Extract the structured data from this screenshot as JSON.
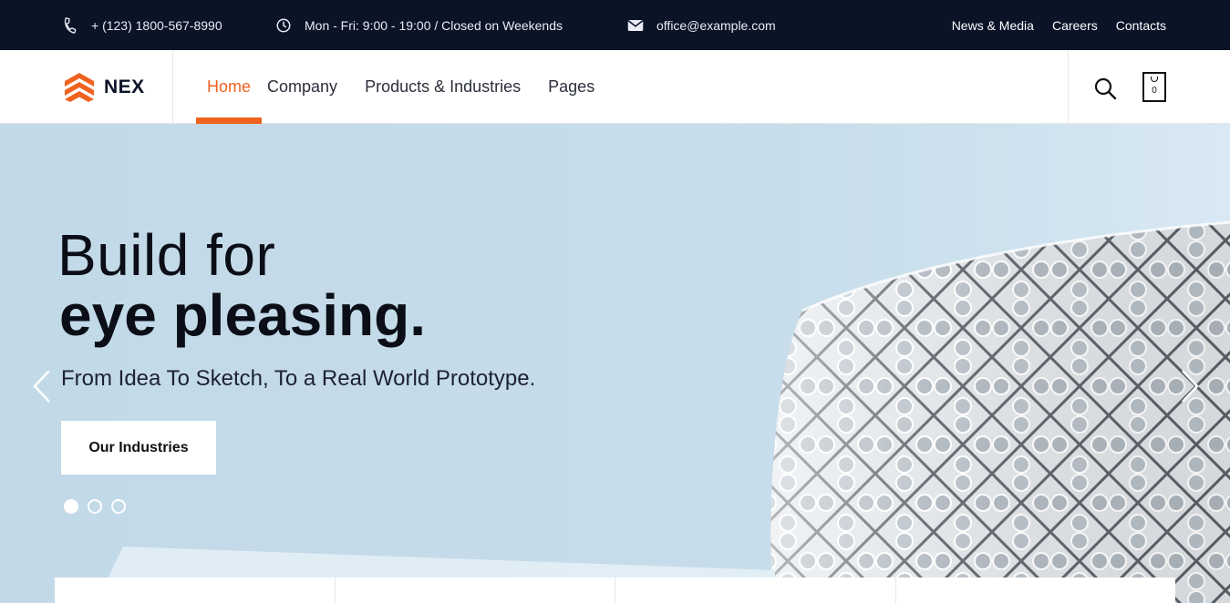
{
  "topbar": {
    "phone": "+ (123) 1800-567-8990",
    "hours": "Mon - Fri: 9:00 - 19:00 / Closed on Weekends",
    "email": "office@example.com",
    "links": [
      "News & Media",
      "Careers",
      "Contacts"
    ],
    "icons": [
      "phone-icon",
      "clock-icon",
      "envelope-icon"
    ]
  },
  "header": {
    "logo_text": "NEX",
    "nav": [
      "Home",
      "Company",
      "Products & Industries",
      "Pages"
    ],
    "active_nav": "Home",
    "cart_count": "0"
  },
  "hero": {
    "title_line1": "Build for",
    "title_line2": "eye pleasing.",
    "subtitle": "From Idea To Sketch, To a Real World Prototype.",
    "cta_label": "Our Industries",
    "slide_total": 3,
    "active_slide": 1
  },
  "colors": {
    "accent": "#f0621f",
    "topbar_bg": "#0b1327",
    "hero_bg": "#c4dae9"
  }
}
